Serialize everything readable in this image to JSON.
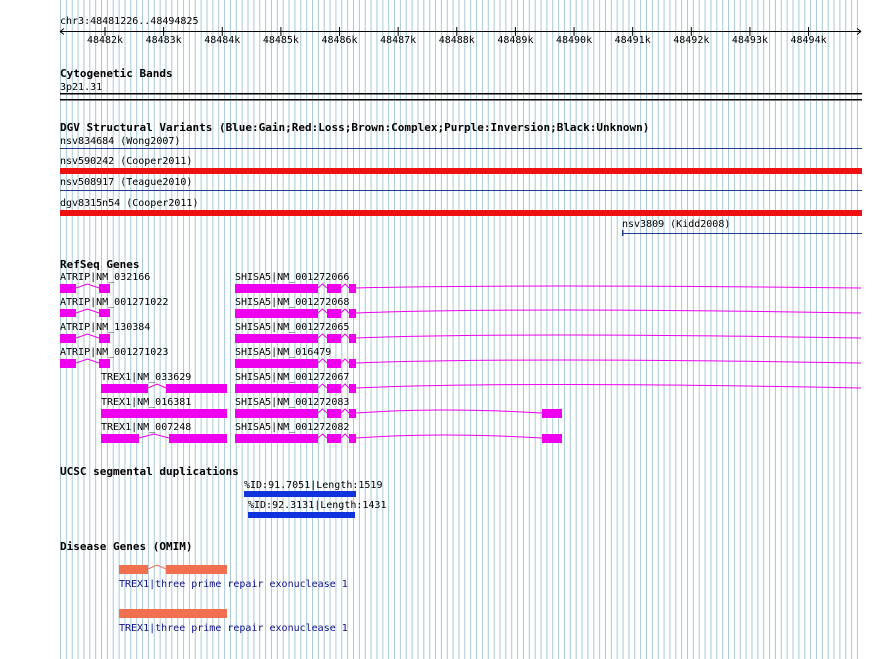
{
  "ruler": {
    "region": "chr3:48481226..48494825",
    "ticks": [
      "48482k",
      "48483k",
      "48484k",
      "48485k",
      "48486k",
      "48487k",
      "48488k",
      "48489k",
      "48490k",
      "48491k",
      "48492k",
      "48493k",
      "48494k"
    ]
  },
  "cytoband": {
    "title": "Cytogenetic Bands",
    "band": "3p21.31"
  },
  "dgv": {
    "title": "DGV Structural Variants (Blue:Gain;Red:Loss;Brown:Complex;Purple:Inversion;Black:Unknown)",
    "items": [
      {
        "label": "nsv834684 (Wong2007)",
        "color": "#1f3d8a",
        "type": "gain"
      },
      {
        "label": "nsv590242 (Cooper2011)",
        "color": "#ee1111",
        "type": "loss"
      },
      {
        "label": "nsv508917 (Teague2010)",
        "color": "#1f3d8a",
        "type": "gain"
      },
      {
        "label": "dgv8315n54 (Cooper2011)",
        "color": "#ee1111",
        "type": "loss"
      },
      {
        "label": "nsv3809 (Kidd2008)",
        "color": "#1f3d8a",
        "type": "gain"
      }
    ]
  },
  "refseq": {
    "title": "RefSeq Genes",
    "color": "#ee00ee",
    "genes": [
      {
        "label": "ATRIP|NM_032166"
      },
      {
        "label": "ATRIP|NM_001271022"
      },
      {
        "label": "ATRIP|NM_130384"
      },
      {
        "label": "ATRIP|NM_001271023"
      },
      {
        "label": "TREX1|NM_033629"
      },
      {
        "label": "TREX1|NM_016381"
      },
      {
        "label": "TREX1|NM_007248"
      },
      {
        "label": "SHISA5|NM_001272066"
      },
      {
        "label": "SHISA5|NM_001272068"
      },
      {
        "label": "SHISA5|NM_001272065"
      },
      {
        "label": "SHISA5|NM_016479"
      },
      {
        "label": "SHISA5|NM_001272067"
      },
      {
        "label": "SHISA5|NM_001272083"
      },
      {
        "label": "SHISA5|NM_001272082"
      }
    ]
  },
  "segdups": {
    "title": "UCSC segmental duplications",
    "color": "#1133dd",
    "items": [
      {
        "label": "%ID:91.7051|Length:1519"
      },
      {
        "label": "%ID:92.3131|Length:1431"
      }
    ]
  },
  "omim": {
    "title": "Disease Genes (OMIM)",
    "color": "#f07050",
    "items": [
      {
        "label": "TREX1|three prime repair exonuclease 1"
      },
      {
        "label": "TREX1|three prime repair exonuclease 1"
      }
    ]
  },
  "colors": {
    "grid": "#a9c9d6",
    "gene": "#ee00ee",
    "loss": "#ee1111",
    "gain": "#1f3d8a",
    "segdup": "#1133dd",
    "omim": "#f07050"
  }
}
